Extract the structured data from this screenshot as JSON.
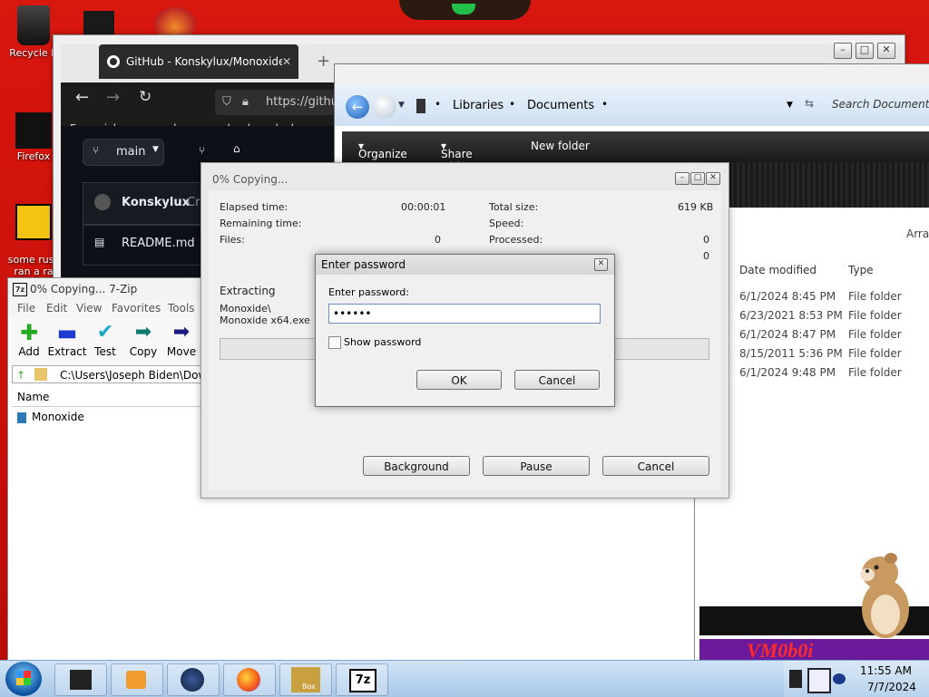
{
  "desktop": {
    "icons": [
      {
        "label": "Recycle B"
      },
      {
        "label": "Firefox"
      },
      {
        "label": "some russ\nran a ra"
      }
    ]
  },
  "browser": {
    "tab_title": "GitHub - Konskylux/Monoxide",
    "url": "https://githu",
    "bookmarks_text": "For quick access, place your bookmarks here on the bo",
    "branch": "main",
    "repo_owner": "Konskylux",
    "repo_owner_suffix": "Cre",
    "readme": "README.md"
  },
  "explorer": {
    "crumbs": [
      "Libraries",
      "Documents"
    ],
    "search_placeholder": "Search Documents",
    "commands": [
      "Organize",
      "Share with",
      "New folder"
    ],
    "arrange": "Arran",
    "columns": [
      "Date modified",
      "Type"
    ],
    "rows": [
      {
        "date": "6/1/2024 8:45 PM",
        "type": "File folder"
      },
      {
        "date": "6/23/2021 8:53 PM",
        "type": "File folder"
      },
      {
        "date": "6/1/2024 8:47 PM",
        "type": "File folder"
      },
      {
        "date": "8/15/2011 5:36 PM",
        "type": "File folder"
      },
      {
        "date": "6/1/2024 9:48 PM",
        "type": "File folder"
      }
    ]
  },
  "zip": {
    "title": "0% Copying... 7-Zip",
    "menu": [
      "File",
      "Edit",
      "View",
      "Favorites",
      "Tools"
    ],
    "tools": [
      "Add",
      "Extract",
      "Test",
      "Copy",
      "Move"
    ],
    "path": "C:\\Users\\Joseph Biden\\Down",
    "name_col": "Name",
    "items": [
      "Monoxide"
    ]
  },
  "copy_dialog": {
    "title": "0% Copying...",
    "elapsed_label": "Elapsed time:",
    "elapsed_value": "00:00:01",
    "remaining_label": "Remaining time:",
    "files_label": "Files:",
    "files_value": "0",
    "total_label": "Total size:",
    "total_value": "619 KB",
    "speed_label": "Speed:",
    "processed_label": "Processed:",
    "processed_value": "0",
    "extra_value": "0",
    "extracting_label": "Extracting",
    "extracting_path": "Monoxide\\",
    "extracting_file": "Monoxide x64.exe",
    "buttons": [
      "Background",
      "Pause",
      "Cancel"
    ]
  },
  "password_dialog": {
    "title": "Enter password",
    "prompt": "Enter password:",
    "value": "••••••",
    "show_password": "Show password",
    "ok": "OK",
    "cancel": "Cancel"
  },
  "taskbar": {
    "time": "11:55 AM",
    "date": "7/7/2024",
    "box_label": "Box",
    "zip_label": "7z"
  },
  "wallpaper": {
    "logo_text": "VM0b0i"
  },
  "colors": {
    "desktop_red": "#d8170f",
    "taskbar_blue": "#a9c8e8",
    "explorer_blue": "#cfe0f2"
  }
}
